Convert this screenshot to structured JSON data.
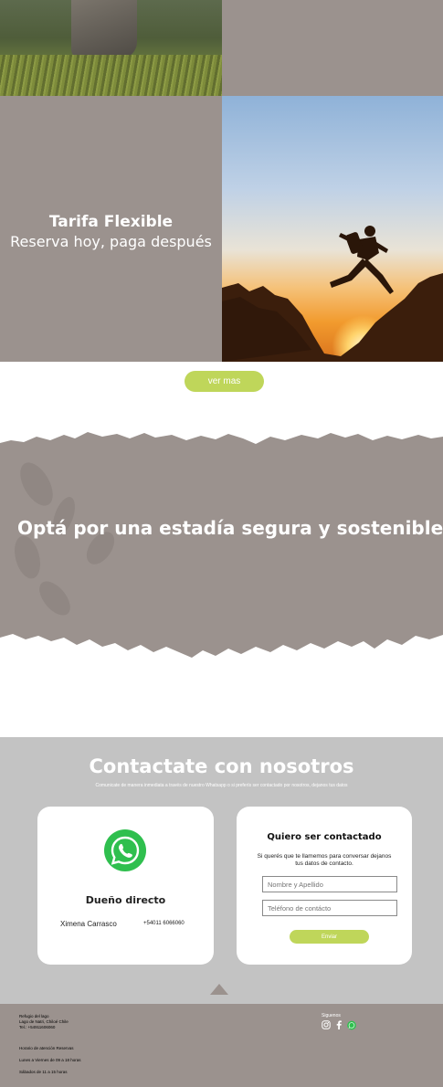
{
  "tarifa": {
    "title": "Tarifa Flexible",
    "subtitle": "Reserva hoy, paga después"
  },
  "ver_mas": "ver mas",
  "banner": {
    "text": "Optá por una estadía segura y sostenible"
  },
  "contact": {
    "title": "Contactate con nosotros",
    "subtitle": "Comunicate de manera inmediata a través de nuestro Whatsapp o si preferís ser contactado por nosotros, dejanos tus datos",
    "owner_card": {
      "title": "Dueño directo",
      "name": "Ximena Carrasco",
      "phone": "+54011 6066060"
    },
    "form_card": {
      "title": "Quiero ser contactado",
      "description": "Si querés que te llamemos para conversar dejanos tus datos de contacto.",
      "name_placeholder": "Nombre y Apellido",
      "phone_placeholder": "Teléfono de contácto",
      "send_label": "Enviar"
    }
  },
  "footer": {
    "address": [
      "Refugio del lago",
      "Lago de Natri, Chiloé Chile",
      "Tel.: +54911606060"
    ],
    "hours_title": "Horario de atención Reservas",
    "hours_weekdays": "Lunes a Viernes de 09 a 18 horas",
    "hours_saturday": "Sábados de 11 a 15 horas",
    "follow_label": "Siguenos",
    "social_icons": [
      "instagram-icon",
      "facebook-icon",
      "whatsapp-icon"
    ]
  },
  "colors": {
    "taupe": "#9b928e",
    "accent_green": "#bfd65a",
    "contact_bg": "#c3c3c3",
    "whatsapp_green": "#2fbf4e"
  }
}
